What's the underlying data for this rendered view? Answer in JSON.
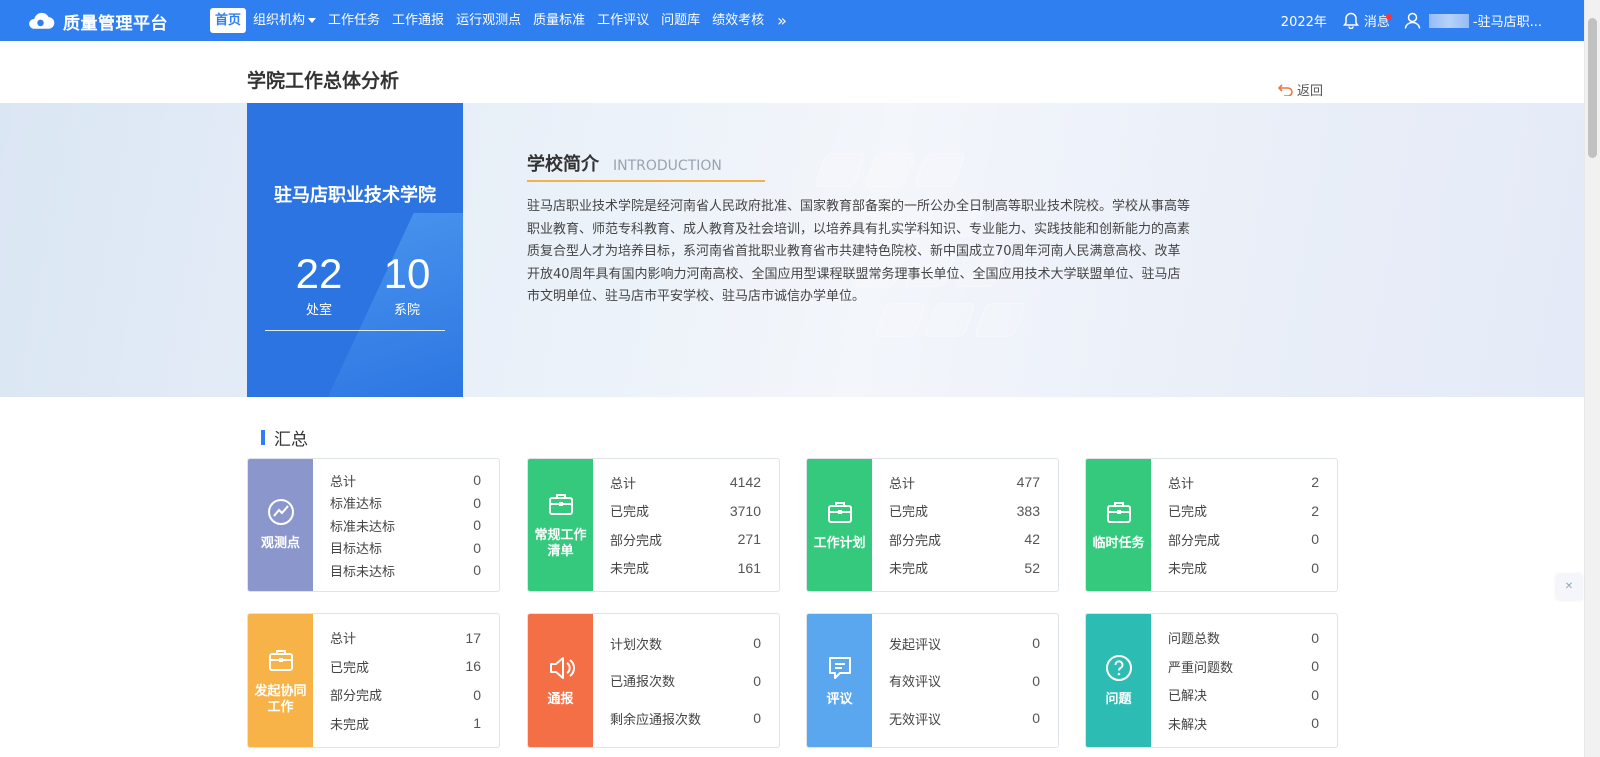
{
  "app": {
    "name": "质量管理平台"
  },
  "nav": {
    "items": [
      "首页",
      "组织机构",
      "工作任务",
      "工作通报",
      "运行观测点",
      "质量标准",
      "工作评议",
      "问题库",
      "绩效考核"
    ],
    "more": "»"
  },
  "topRight": {
    "year": "2022年",
    "message": "消息",
    "user": "-驻马店职..."
  },
  "page": {
    "title": "学院工作总体分析",
    "back": "返回"
  },
  "school": {
    "name": "驻马店职业技术学院",
    "stats": [
      {
        "value": "22",
        "label": "处室"
      },
      {
        "value": "10",
        "label": "系院"
      }
    ]
  },
  "intro": {
    "title": "学校简介",
    "title_en": "INTRODUCTION",
    "text": "驻马店职业技术学院是经河南省人民政府批准、国家教育部备案的一所公办全日制高等职业技术院校。学校从事高等职业教育、师范专科教育、成人教育及社会培训，以培养具有扎实学科知识、专业能力、实践技能和创新能力的高素质复合型人才为培养目标，系河南省首批职业教育省市共建特色院校、新中国成立70周年河南人民满意高校、改革开放40周年具有国内影响力河南高校、全国应用型课程联盟常务理事长单位、全国应用技术大学联盟单位、驻马店市文明单位、驻马店市平安学校、驻马店市诚信办学单位。"
  },
  "summary": {
    "title": "汇总",
    "cards": [
      {
        "label": "观测点",
        "color": "#8b97cc",
        "icon": "trend-icon",
        "rows": [
          [
            "总计",
            "0"
          ],
          [
            "标准达标",
            "0"
          ],
          [
            "标准未达标",
            "0"
          ],
          [
            "目标达标",
            "0"
          ],
          [
            "目标未达标",
            "0"
          ]
        ]
      },
      {
        "label": "常规工作清单",
        "color": "#34c97c",
        "icon": "briefcase-icon",
        "rows": [
          [
            "总计",
            "4142"
          ],
          [
            "已完成",
            "3710"
          ],
          [
            "部分完成",
            "271"
          ],
          [
            "未完成",
            "161"
          ]
        ]
      },
      {
        "label": "工作计划",
        "color": "#34c97c",
        "icon": "briefcase-icon",
        "rows": [
          [
            "总计",
            "477"
          ],
          [
            "已完成",
            "383"
          ],
          [
            "部分完成",
            "42"
          ],
          [
            "未完成",
            "52"
          ]
        ]
      },
      {
        "label": "临时任务",
        "color": "#34c97c",
        "icon": "briefcase-icon",
        "rows": [
          [
            "总计",
            "2"
          ],
          [
            "已完成",
            "2"
          ],
          [
            "部分完成",
            "0"
          ],
          [
            "未完成",
            "0"
          ]
        ]
      },
      {
        "label": "发起协同工作",
        "color": "#f7b347",
        "icon": "briefcase-icon",
        "rows": [
          [
            "总计",
            "17"
          ],
          [
            "已完成",
            "16"
          ],
          [
            "部分完成",
            "0"
          ],
          [
            "未完成",
            "1"
          ]
        ]
      },
      {
        "label": "通报",
        "color": "#f46f45",
        "icon": "speaker-icon",
        "rows": [
          [
            "计划次数",
            "0"
          ],
          [
            "已通报次数",
            "0"
          ],
          [
            "剩余应通报次数",
            "0"
          ]
        ]
      },
      {
        "label": "评议",
        "color": "#5aa7ef",
        "icon": "comment-icon",
        "rows": [
          [
            "发起评议",
            "0"
          ],
          [
            "有效评议",
            "0"
          ],
          [
            "无效评议",
            "0"
          ]
        ]
      },
      {
        "label": "问题",
        "color": "#2cbcb4",
        "icon": "question-icon",
        "rows": [
          [
            "问题总数",
            "0"
          ],
          [
            "严重问题数",
            "0"
          ],
          [
            "已解决",
            "0"
          ],
          [
            "未解决",
            "0"
          ]
        ]
      }
    ]
  }
}
